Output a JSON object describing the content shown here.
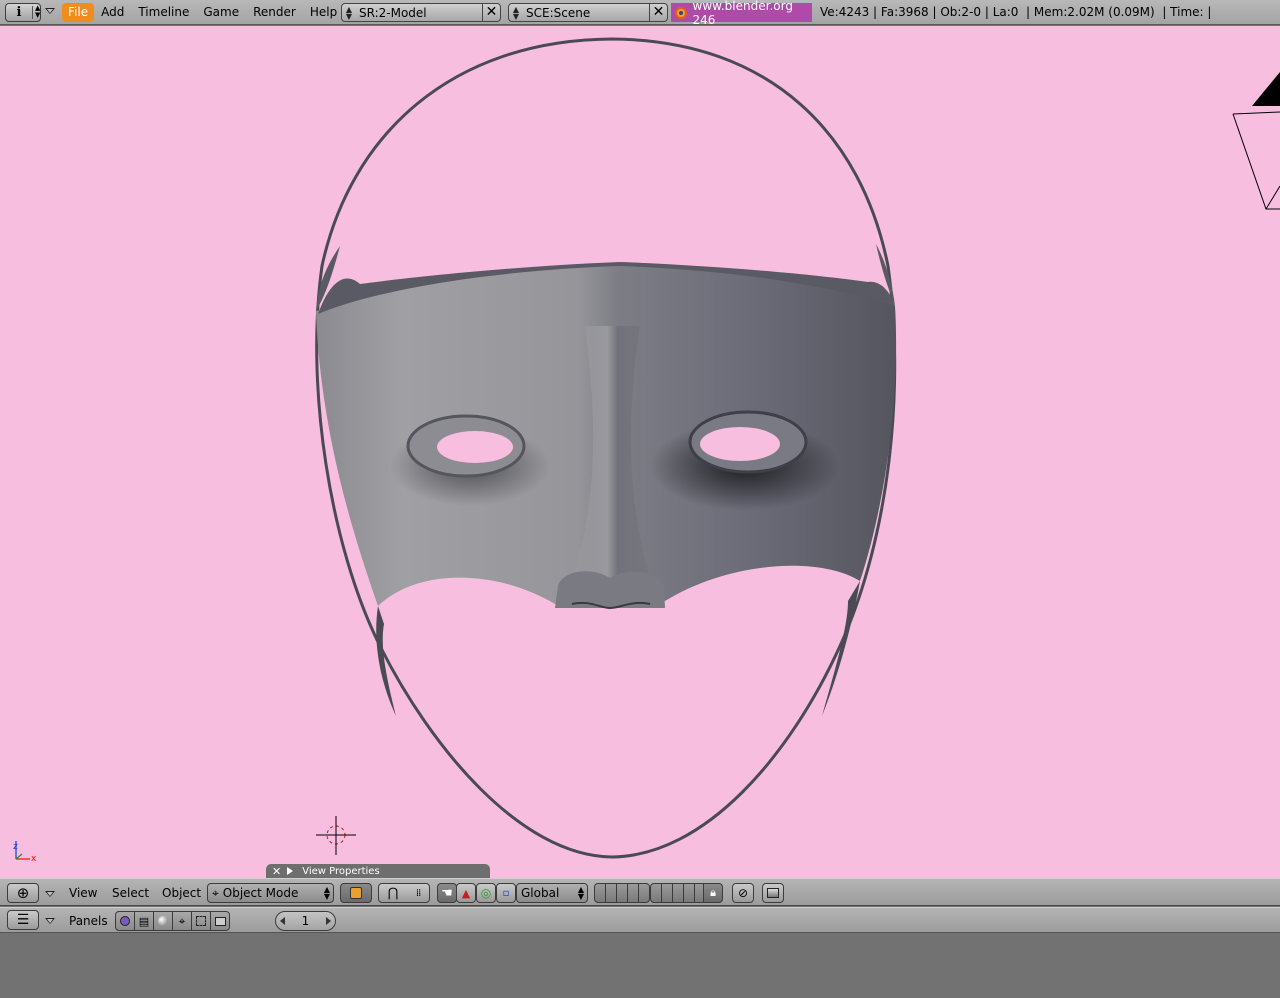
{
  "info_header": {
    "menus": [
      "File",
      "Add",
      "Timeline",
      "Game",
      "Render",
      "Help"
    ],
    "active_menu": "File",
    "screen_field": "SR:2-Model",
    "scene_field": "SCE:Scene",
    "website": "www.blender.org 246",
    "stats": "Ve:4243 | Fa:3968 | Ob:2-0 | La:0  | Mem:2.02M (0.09M)  | Time: |"
  },
  "viewport": {
    "background_color": "#f8bee0",
    "object": "mask",
    "axis_labels": {
      "z": "z",
      "x": "x"
    },
    "view_properties_label": "View Properties"
  },
  "view_header": {
    "menus": [
      "View",
      "Select",
      "Object"
    ],
    "mode": "Object Mode",
    "orientation": "Global"
  },
  "buttons_header": {
    "panels_label": "Panels",
    "frame_value": "1"
  },
  "colors": {
    "header_gray": "#a8a8a8",
    "active_menu_orange": "#f08c1e",
    "link_purple": "#b04aa8",
    "viewport_pink": "#f8bee0"
  }
}
